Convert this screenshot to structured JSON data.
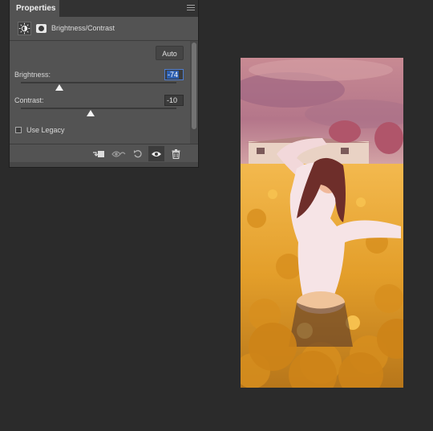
{
  "panel": {
    "tab_label": "Properties",
    "adjustment_title": "Brightness/Contrast",
    "auto_label": "Auto",
    "brightness": {
      "label": "Brightness:",
      "value": "-74",
      "slider_fraction": 0.245
    },
    "contrast": {
      "label": "Contrast:",
      "value": "-10",
      "slider_fraction": 0.45
    },
    "use_legacy": {
      "label": "Use Legacy",
      "checked": false
    }
  },
  "footer_icons": [
    "clip-to-layer-icon",
    "view-previous-state-icon",
    "reset-icon",
    "visibility-eye-icon",
    "trash-icon"
  ],
  "colors": {
    "panel_bg": "#535353",
    "workspace_bg": "#2b2b2b",
    "field_focus": "#2d5fb0"
  }
}
